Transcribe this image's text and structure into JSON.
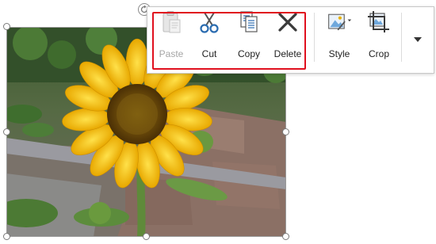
{
  "toolbar": {
    "paste_label": "Paste",
    "cut_label": "Cut",
    "copy_label": "Copy",
    "delete_label": "Delete",
    "style_label": "Style",
    "crop_label": "Crop"
  },
  "icons": {
    "paste": "clipboard-icon",
    "cut": "scissors-icon",
    "copy": "copy-icon",
    "delete": "x-icon",
    "style": "picture-style-icon",
    "crop": "crop-icon",
    "more": "chevron-down-icon",
    "rotate": "rotate-icon"
  },
  "colors": {
    "accent_blue": "#2b6cb0",
    "highlight_red": "#e0101e",
    "disabled_text": "#a6a6a6"
  },
  "image": {
    "subject": "sunflower-photo"
  }
}
